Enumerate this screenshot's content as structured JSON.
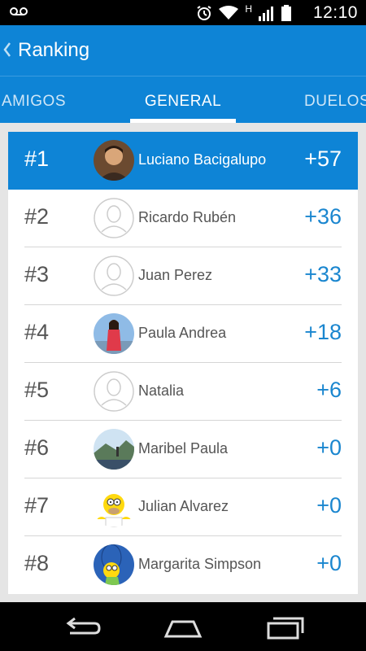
{
  "status": {
    "time": "12:10",
    "network": "H"
  },
  "header": {
    "title": "Ranking"
  },
  "tabs": [
    {
      "label": "AMIGOS",
      "active": false
    },
    {
      "label": "GENERAL",
      "active": true
    },
    {
      "label": "DUELOS",
      "active": false
    }
  ],
  "ranking": [
    {
      "rank": "#1",
      "name": "Luciano Bacigalupo",
      "points": "+57",
      "avatar": "photo-man-icon",
      "highlighted": true
    },
    {
      "rank": "#2",
      "name": "Ricardo Rubén",
      "points": "+36",
      "avatar": "default-avatar-icon"
    },
    {
      "rank": "#3",
      "name": "Juan Perez",
      "points": "+33",
      "avatar": "default-avatar-icon"
    },
    {
      "rank": "#4",
      "name": "Paula Andrea",
      "points": "+18",
      "avatar": "photo-woman-icon"
    },
    {
      "rank": "#5",
      "name": "Natalia",
      "points": "+6",
      "avatar": "default-avatar-icon"
    },
    {
      "rank": "#6",
      "name": "Maribel Paula",
      "points": "+0",
      "avatar": "photo-landscape-icon"
    },
    {
      "rank": "#7",
      "name": "Julian Alvarez",
      "points": "+0",
      "avatar": "homer-cartoon-icon"
    },
    {
      "rank": "#8",
      "name": "Margarita Simpson",
      "points": "+0",
      "avatar": "marge-cartoon-icon"
    }
  ],
  "colors": {
    "primary": "#0e84d6",
    "points": "#1a86cf",
    "text": "#555555",
    "background": "#e5e5e5"
  }
}
